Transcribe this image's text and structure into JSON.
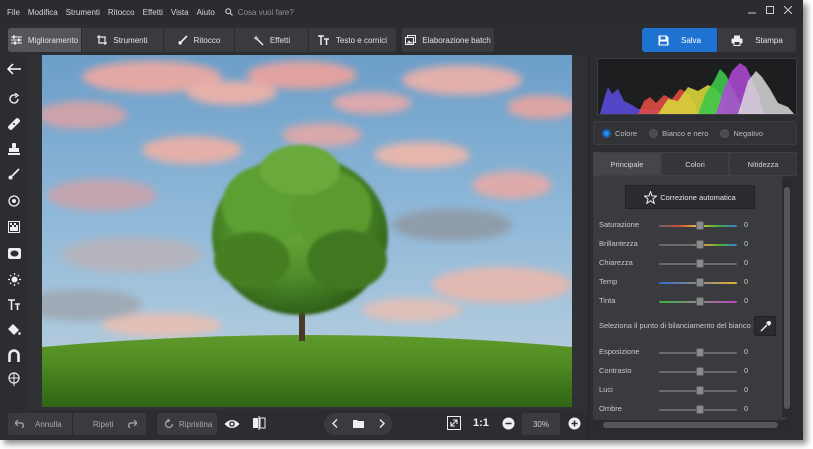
{
  "menu": {
    "items": [
      "File",
      "Modifica",
      "Strumenti",
      "Ritocco",
      "Effetti",
      "Vista",
      "Aiuto"
    ],
    "search_placeholder": "Cosa vuoi fare?"
  },
  "toolbar": {
    "tabs": [
      "Miglioramento",
      "Strumenti",
      "Ritocco",
      "Effetti",
      "Testo e cornici"
    ],
    "batch_label": "Elaborazione batch",
    "save_label": "Salva",
    "print_label": "Stampa"
  },
  "bottom": {
    "undo_label": "Annulla",
    "redo_label": "Ripeti",
    "reset_label": "Ripristina",
    "fit_label": "1:1",
    "zoom_value": "30%"
  },
  "panel": {
    "modes": [
      "Colore",
      "Bianco e nero",
      "Negativo"
    ],
    "selected_mode": "Colore",
    "tabs": [
      "Principale",
      "Colori",
      "Nitidezza"
    ],
    "active_tab": "Principale",
    "auto_label": "Correzione automatica",
    "white_balance_label": "Seleziona il punto di bilanciamento del bianco",
    "sliders_top": [
      {
        "label": "Saturazione",
        "value": "0"
      },
      {
        "label": "Brillantezza",
        "value": "0"
      },
      {
        "label": "Chiarezza",
        "value": "0"
      },
      {
        "label": "Temp",
        "value": "0"
      },
      {
        "label": "Tinta",
        "value": "0"
      }
    ],
    "sliders_bottom": [
      {
        "label": "Esposizione",
        "value": "0"
      },
      {
        "label": "Contrasto",
        "value": "0"
      },
      {
        "label": "Luci",
        "value": "0"
      },
      {
        "label": "Ombre",
        "value": "0"
      }
    ]
  },
  "colors": {
    "accent": "#1e73d2",
    "panel_bg": "#2c2d30"
  }
}
